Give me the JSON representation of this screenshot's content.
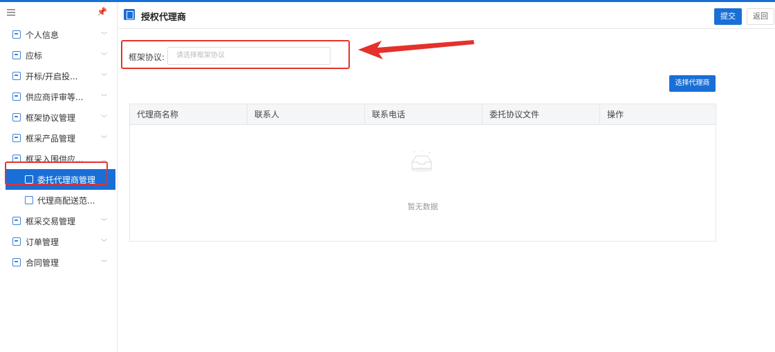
{
  "sidebar": {
    "items": [
      {
        "label": "个人信息",
        "icon": "person-doc-icon"
      },
      {
        "label": "应标",
        "icon": "bid-icon"
      },
      {
        "label": "开标/开启投...",
        "icon": "open-bid-icon"
      },
      {
        "label": "供应商评审等...",
        "icon": "review-icon"
      },
      {
        "label": "框架协议管理",
        "icon": "agreement-icon"
      },
      {
        "label": "框采产品管理",
        "icon": "product-icon"
      },
      {
        "label": "框采入围供应...",
        "icon": "shortlist-icon"
      }
    ],
    "subitems": [
      {
        "label": "委托代理商管理",
        "icon": "agent-icon",
        "active": true
      },
      {
        "label": "代理商配送范...",
        "icon": "delivery-icon",
        "active": false
      }
    ],
    "items_after": [
      {
        "label": "框采交易管理",
        "icon": "trade-icon"
      },
      {
        "label": "订单管理",
        "icon": "order-icon"
      },
      {
        "label": "合同管理",
        "icon": "contract-icon"
      }
    ]
  },
  "header": {
    "title": "授权代理商",
    "submit_label": "提交",
    "back_label": "返回"
  },
  "form": {
    "agreement_label": "框架协议:",
    "agreement_placeholder": "请选择框架协议"
  },
  "select_agent_label": "选择代理商",
  "table": {
    "columns": [
      "代理商名称",
      "联系人",
      "联系电话",
      "委托协议文件",
      "操作"
    ],
    "empty_text": "暂无数据"
  },
  "colors": {
    "primary": "#1a6fd6",
    "highlight": "#e5312b"
  }
}
